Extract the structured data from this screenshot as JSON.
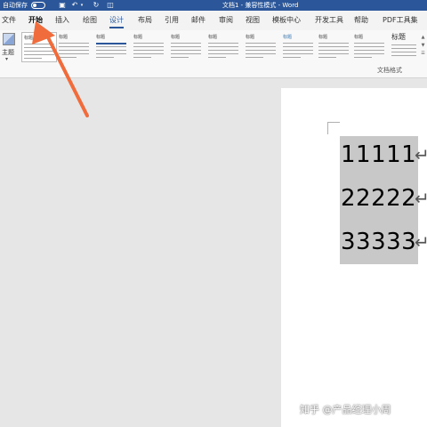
{
  "titlebar": {
    "autosave_label": "自动保存",
    "doc_title": "文档1 - 兼容性模式 - Word",
    "quick_icons": [
      "save-icon",
      "undo-icon",
      "undo-dropdown-icon",
      "redo-icon",
      "format-painter-icon"
    ]
  },
  "tabs": [
    {
      "label": "文件"
    },
    {
      "label": "开始"
    },
    {
      "label": "插入"
    },
    {
      "label": "绘图"
    },
    {
      "label": "设计"
    },
    {
      "label": "布局"
    },
    {
      "label": "引用"
    },
    {
      "label": "邮件"
    },
    {
      "label": "审阅"
    },
    {
      "label": "视图"
    },
    {
      "label": "模板中心"
    },
    {
      "label": "开发工具"
    },
    {
      "label": "帮助"
    },
    {
      "label": "PDF工具集"
    }
  ],
  "ribbon": {
    "theme_label": "主题",
    "style_titles": [
      "标题 1",
      "标题",
      "标题",
      "标题",
      "标题",
      "标题",
      "标题",
      "标题",
      "标题",
      "标题",
      "标题"
    ],
    "last_style_title": "标题",
    "group_label": "文档格式"
  },
  "document": {
    "lines": [
      "11111",
      "22222",
      "33333"
    ],
    "para_mark": "↵"
  },
  "watermark": "知乎 @产品经理小周",
  "colors": {
    "title_bar": "#2b579a",
    "annotation_arrow": "#f06c3c",
    "selection": "#c8c8c8"
  }
}
